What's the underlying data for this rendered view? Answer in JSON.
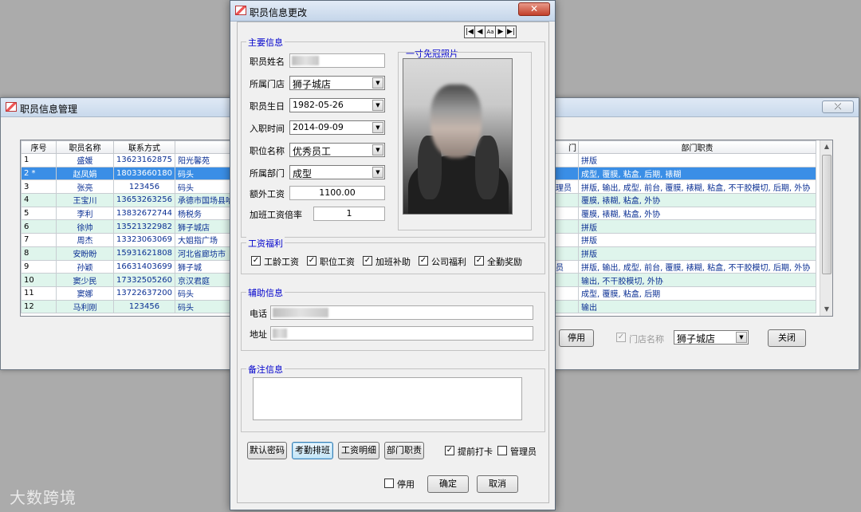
{
  "bg_window": {
    "title": "职员信息管理",
    "close_label": "⤫",
    "grid": {
      "headers_left": [
        "序号",
        "职员名称",
        "联系方式",
        ""
      ],
      "headers_right": [
        "门",
        "部门职责"
      ],
      "rows": [
        {
          "no": "1",
          "name": "盛媛",
          "phone": "13623162875",
          "addr": "阳光馨苑",
          "rpre": "",
          "duty": "拼版"
        },
        {
          "no": "2 *",
          "name": "赵凤娟",
          "phone": "18033660180",
          "addr": "码头",
          "rpre": "",
          "duty": "成型, 覆膜, 粘盒, 后期, 裱糊"
        },
        {
          "no": "3",
          "name": "张亮",
          "phone": "123456",
          "addr": "码头",
          "rpre": "理员",
          "duty": "拼版, 输出, 成型, 前台, 覆膜, 裱糊, 粘盒, 不干胶模切, 后期, 外协"
        },
        {
          "no": "4",
          "name": "王宝川",
          "phone": "13653263256",
          "addr": "承德市国场县哈里",
          "rpre": "",
          "duty": "覆膜, 裱糊, 粘盒, 外协"
        },
        {
          "no": "5",
          "name": "李利",
          "phone": "13832672744",
          "addr": "杨税务",
          "rpre": "",
          "duty": "覆膜, 裱糊, 粘盒, 外协"
        },
        {
          "no": "6",
          "name": "徐帅",
          "phone": "13521322982",
          "addr": "狮子城店",
          "rpre": "",
          "duty": "拼版"
        },
        {
          "no": "7",
          "name": "周杰",
          "phone": "13323063069",
          "addr": "大姐指广场",
          "rpre": "",
          "duty": "拼版"
        },
        {
          "no": "8",
          "name": "安盼盼",
          "phone": "15931621808",
          "addr": "河北省廊坊市",
          "rpre": "",
          "duty": "拼版"
        },
        {
          "no": "9",
          "name": "孙颖",
          "phone": "16631403699",
          "addr": "狮子城",
          "rpre": "员",
          "duty": "拼版, 输出, 成型, 前台, 覆膜, 裱糊, 粘盒, 不干胶模切, 后期, 外协"
        },
        {
          "no": "10",
          "name": "窦少民",
          "phone": "17332505260",
          "addr": "京汉君庭",
          "rpre": "",
          "duty": "输出, 不干胶模切, 外协"
        },
        {
          "no": "11",
          "name": "窦娜",
          "phone": "13722637200",
          "addr": "码头",
          "rpre": "",
          "duty": "成型, 覆膜, 粘盒, 后期"
        },
        {
          "no": "12",
          "name": "马利刚",
          "phone": "123456",
          "addr": "码头",
          "rpre": "",
          "duty": "输出"
        }
      ]
    },
    "disable_label": "停用",
    "store_filter_label": "门店名称",
    "store_filter_check": "✓",
    "store_filter_value": "狮子城店",
    "close_button_label": "关闭"
  },
  "dialog": {
    "title": "职员信息更改",
    "nav": [
      "|◀",
      "◀",
      "Aa",
      "▶",
      "▶|"
    ],
    "main_info": {
      "legend": "主要信息",
      "name_label": "职员姓名",
      "store_label": "所属门店",
      "store_value": "狮子城店",
      "birthday_label": "职员生日",
      "birthday_value": "1982-05-26",
      "hire_label": "入职时间",
      "hire_value": "2014-09-09",
      "position_label": "职位名称",
      "position_value": "优秀员工",
      "dept_label": "所属部门",
      "dept_value": "成型",
      "extra_pay_label": "额外工资",
      "extra_pay_value": "1100.00",
      "ot_rate_label": "加班工资倍率",
      "ot_rate_value": "1",
      "photo_legend": "一寸免冠照片"
    },
    "benefits": {
      "legend": "工资福利",
      "items": [
        "工龄工资",
        "职位工资",
        "加班补助",
        "公司福利",
        "全勤奖励"
      ],
      "check": "✓"
    },
    "aux": {
      "legend": "辅助信息",
      "phone_label": "电话",
      "address_label": "地址"
    },
    "notes": {
      "legend": "备注信息"
    },
    "buttons": {
      "default_pwd": "默认密码",
      "attendance": "考勤排班",
      "salary_detail": "工资明细",
      "dept_duty": "部门职责",
      "early_clock_label": "提前打卡",
      "early_clock_check": "✓",
      "admin_label": "管理员",
      "disable_label": "停用",
      "confirm": "确定",
      "cancel": "取消"
    }
  },
  "watermark": "大数跨境"
}
